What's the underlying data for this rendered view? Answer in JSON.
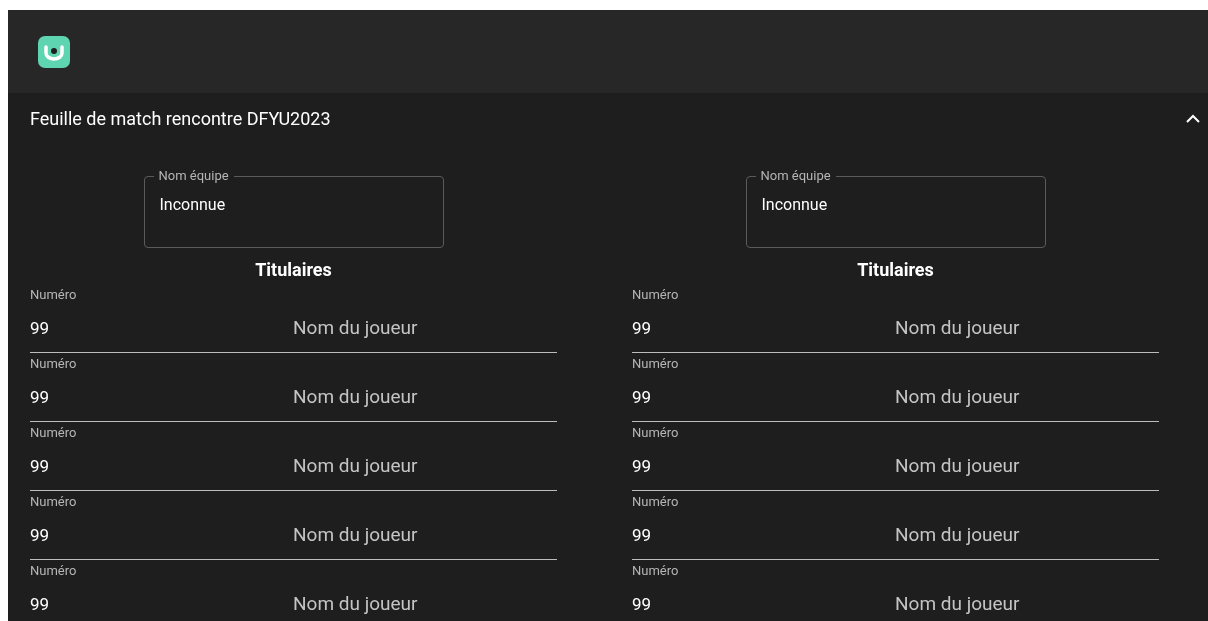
{
  "panel": {
    "title": "Feuille de match rencontre DFYU2023",
    "expanded": true
  },
  "teams": [
    {
      "team_field": {
        "label": "Nom équipe",
        "value": "Inconnue"
      },
      "section_title": "Titulaires",
      "players": [
        {
          "number_label": "Numéro",
          "number": "99",
          "name_placeholder": "Nom du joueur"
        },
        {
          "number_label": "Numéro",
          "number": "99",
          "name_placeholder": "Nom du joueur"
        },
        {
          "number_label": "Numéro",
          "number": "99",
          "name_placeholder": "Nom du joueur"
        },
        {
          "number_label": "Numéro",
          "number": "99",
          "name_placeholder": "Nom du joueur"
        },
        {
          "number_label": "Numéro",
          "number": "99",
          "name_placeholder": "Nom du joueur"
        }
      ]
    },
    {
      "team_field": {
        "label": "Nom équipe",
        "value": "Inconnue"
      },
      "section_title": "Titulaires",
      "players": [
        {
          "number_label": "Numéro",
          "number": "99",
          "name_placeholder": "Nom du joueur"
        },
        {
          "number_label": "Numéro",
          "number": "99",
          "name_placeholder": "Nom du joueur"
        },
        {
          "number_label": "Numéro",
          "number": "99",
          "name_placeholder": "Nom du joueur"
        },
        {
          "number_label": "Numéro",
          "number": "99",
          "name_placeholder": "Nom du joueur"
        },
        {
          "number_label": "Numéro",
          "number": "99",
          "name_placeholder": "Nom du joueur"
        }
      ]
    }
  ]
}
